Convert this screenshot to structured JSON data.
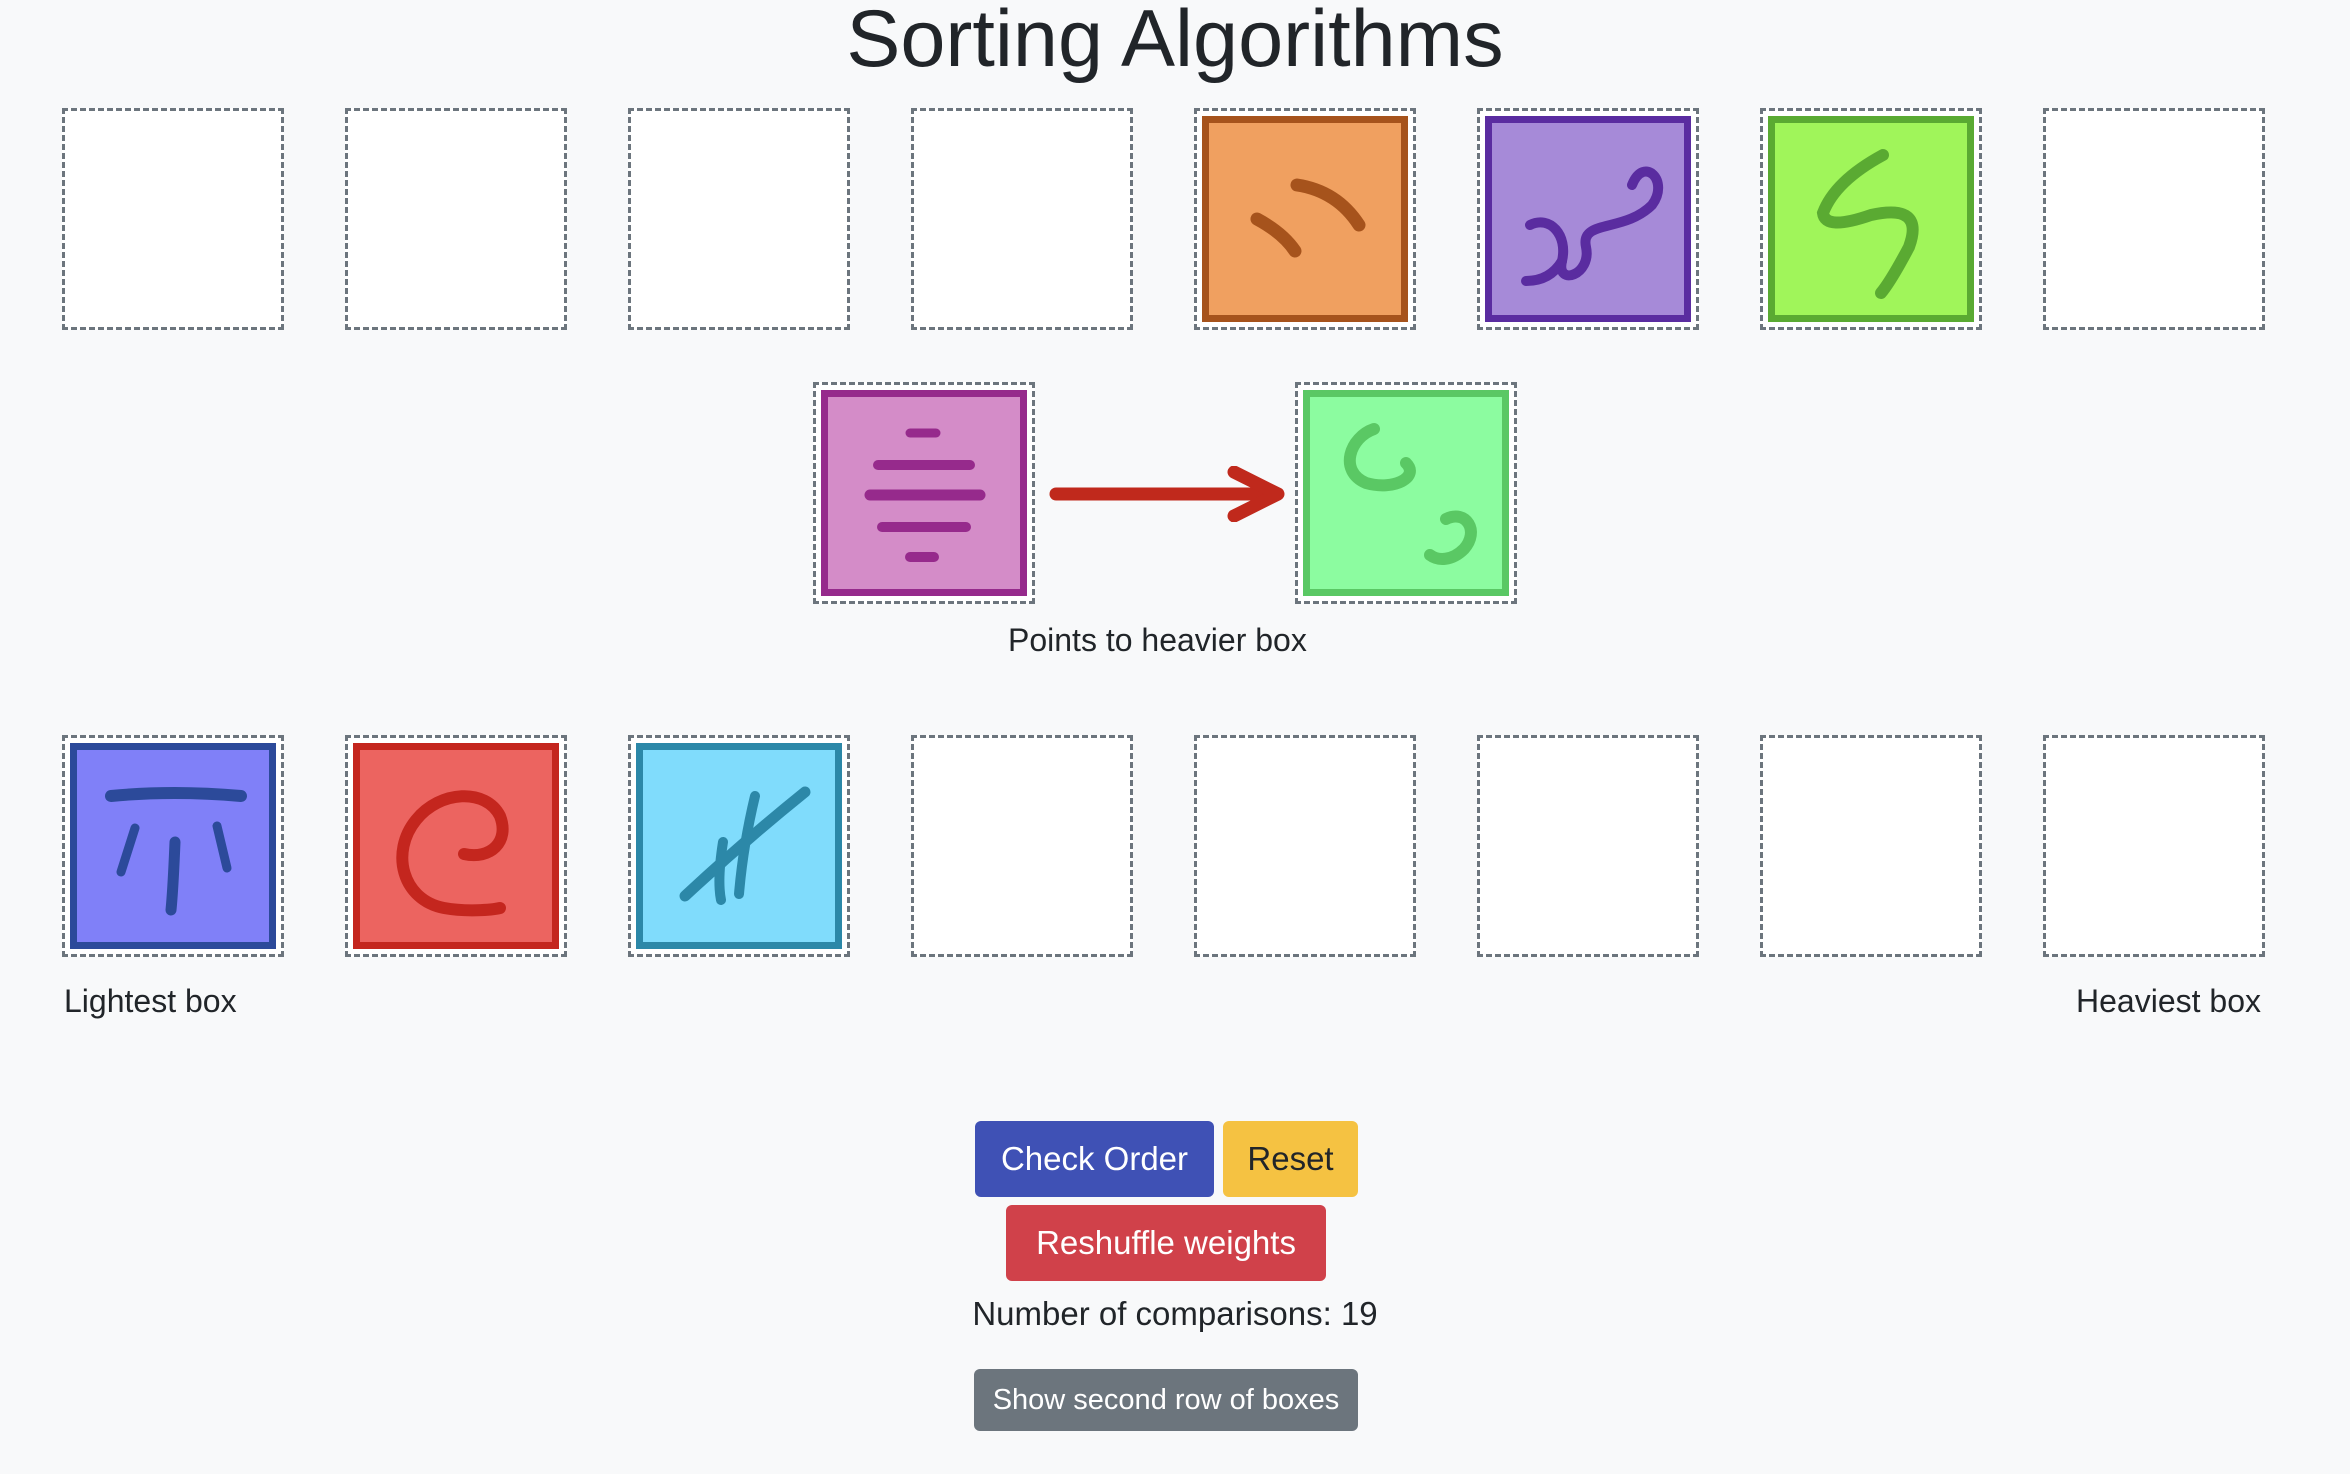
{
  "page": {
    "title": "Sorting Algorithms"
  },
  "comparison": {
    "caption": "Points to heavier box",
    "arrow_color": "#c0291c"
  },
  "labels": {
    "lightest": "Lightest box",
    "heaviest": "Heaviest box"
  },
  "buttons": {
    "check_order": "Check Order",
    "reset": "Reset",
    "reshuffle": "Reshuffle weights",
    "show_second_row": "Show second row of boxes"
  },
  "stats": {
    "comparisons_text": "Number of comparisons: 19",
    "comparisons": 19
  },
  "boxes": {
    "orange": {
      "fill": "#f0a060",
      "border": "#a6531c",
      "glyph": "two-strokes"
    },
    "purple": {
      "fill": "#a68ad8",
      "border": "#5a2ca0",
      "glyph": "curly-w"
    },
    "lime": {
      "fill": "#a0f55a",
      "border": "#5aaa32",
      "glyph": "s-squiggle"
    },
    "pink": {
      "fill": "#d48cc8",
      "border": "#962a8c",
      "glyph": "horizontal-lines"
    },
    "mint": {
      "fill": "#8cfca0",
      "border": "#5ac864",
      "glyph": "two-hooks"
    },
    "blue": {
      "fill": "#8080f8",
      "border": "#2c4a9a",
      "glyph": "pi-like"
    },
    "red": {
      "fill": "#ec6460",
      "border": "#c4261e",
      "glyph": "spiral-c"
    },
    "cyan": {
      "fill": "#80dcfc",
      "border": "#2c88a8",
      "glyph": "hash-like"
    }
  },
  "top_row": [
    "empty",
    "empty",
    "empty",
    "empty",
    "orange",
    "purple",
    "lime",
    "empty"
  ],
  "bottom_row": [
    "blue",
    "red",
    "cyan",
    "empty",
    "empty",
    "empty",
    "empty",
    "empty"
  ]
}
